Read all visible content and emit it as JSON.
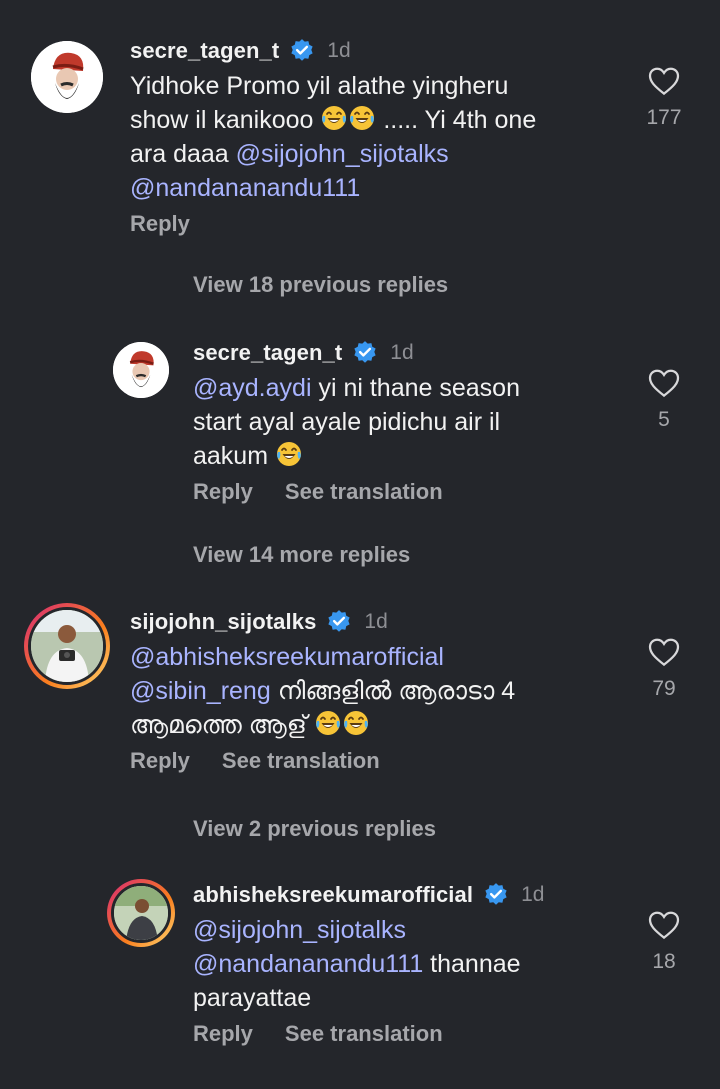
{
  "comments": [
    {
      "username": "secre_tagen_t",
      "time": "1d",
      "lines": [
        [
          {
            "t": "Yidhoke Promo yil alathe yingheru"
          }
        ],
        [
          {
            "t": "show il kanikooo "
          },
          {
            "emoji": "laughing-tears"
          },
          {
            "emoji": "laughing-tears"
          },
          {
            "t": " ..... Yi 4th one"
          }
        ],
        [
          {
            "t": "ara daaa "
          },
          {
            "m": "@sijojohn_sijotalks"
          }
        ],
        [
          {
            "m": "@nandananandu111"
          }
        ]
      ],
      "reply_label": "Reply",
      "translation_label": "",
      "likes": "177"
    },
    {
      "username": "secre_tagen_t",
      "time": "1d",
      "lines": [
        [
          {
            "m": "@ayd.aydi"
          },
          {
            "t": " yi ni thane season"
          }
        ],
        [
          {
            "t": "start ayal ayale pidichu air il"
          }
        ],
        [
          {
            "t": "aakum "
          },
          {
            "emoji": "laughing-tears"
          }
        ]
      ],
      "reply_label": "Reply",
      "translation_label": "See translation",
      "likes": "5"
    },
    {
      "username": "sijojohn_sijotalks",
      "time": "1d",
      "lines": [
        [
          {
            "m": "@abhisheksreekumarofficial"
          }
        ],
        [
          {
            "m": "@sibin_reng"
          },
          {
            "t": " നിങ്ങളിൽ ആരാടാ 4"
          }
        ],
        [
          {
            "t": "ആമത്തെ ആള് "
          },
          {
            "emoji": "laughing-tears"
          },
          {
            "emoji": "laughing-tears"
          }
        ]
      ],
      "reply_label": "Reply",
      "translation_label": "See translation",
      "likes": "79"
    },
    {
      "username": "abhisheksreekumarofficial",
      "time": "1d",
      "lines": [
        [
          {
            "m": "@sijojohn_sijotalks"
          }
        ],
        [
          {
            "m": "@nandananandu111"
          },
          {
            "t": " thannae"
          }
        ],
        [
          {
            "t": "parayattae"
          }
        ]
      ],
      "reply_label": "Reply",
      "translation_label": "See translation",
      "likes": "18"
    }
  ],
  "view_replies": [
    "View 18 previous replies",
    "View 14 more replies",
    "View 2 previous replies"
  ],
  "colors": {
    "background": "#24262b",
    "mention": "#a9b4ff",
    "verified": "#3897f0",
    "muted": "#a6a7ab"
  }
}
